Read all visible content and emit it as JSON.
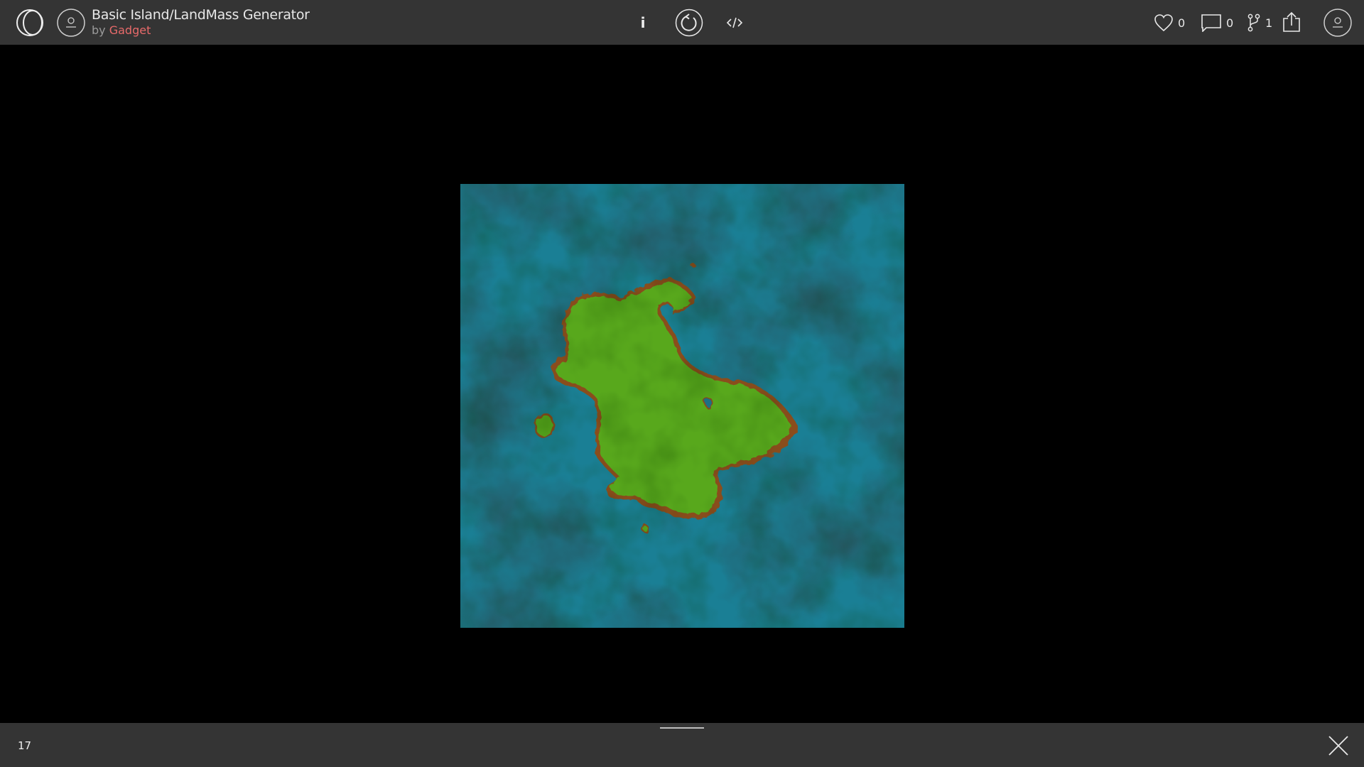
{
  "header": {
    "title": "Basic Island/LandMass Generator",
    "by_prefix": "by",
    "author": "Gadget",
    "info_label": "i",
    "likes": "0",
    "comments": "0",
    "forks": "1"
  },
  "footer": {
    "frame_counter": "17"
  },
  "colors": {
    "bar": "#343434",
    "author": "#e86a6a",
    "water": "#1a7f95",
    "land": "#58a81f",
    "shore": "#8a4e1e"
  }
}
